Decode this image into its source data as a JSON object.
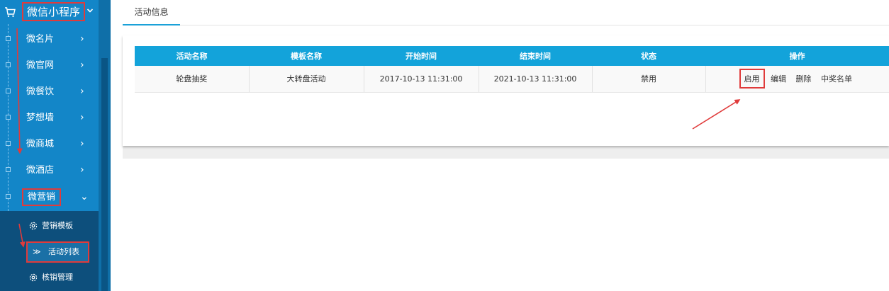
{
  "sidebar": {
    "header_title": "微信小程序",
    "items": [
      {
        "label": "微名片",
        "chevron": "›"
      },
      {
        "label": "微官网",
        "chevron": "›"
      },
      {
        "label": "微餐饮",
        "chevron": "›"
      },
      {
        "label": "梦想墙",
        "chevron": "›"
      },
      {
        "label": "微商城",
        "chevron": "›"
      },
      {
        "label": "微酒店",
        "chevron": "›"
      },
      {
        "label": "微营销",
        "chevron": "⌄"
      }
    ],
    "sub_items": [
      {
        "label": "营销模板",
        "icon": "gear-icon"
      },
      {
        "label": "活动列表",
        "icon": "double-chevron-right-icon",
        "arrow": "≫"
      },
      {
        "label": "核销管理",
        "icon": "gear-icon"
      }
    ]
  },
  "tabs": [
    {
      "label": "活动信息"
    }
  ],
  "table": {
    "headers": [
      "活动名称",
      "模板名称",
      "开始时间",
      "结束时间",
      "状态",
      "操作"
    ],
    "rows": [
      {
        "name": "轮盘抽奖",
        "template": "大转盘活动",
        "start": "2017-10-13 11:31:00",
        "end": "2021-10-13 11:31:00",
        "status": "禁用",
        "actions": [
          "启用",
          "编辑",
          "删除",
          "中奖名单"
        ]
      }
    ]
  },
  "colors": {
    "sidebar": "#1386c8",
    "sidebar_sub": "#0d4f7c",
    "table_header": "#13a3da",
    "annotation_red": "#e03b3b"
  }
}
